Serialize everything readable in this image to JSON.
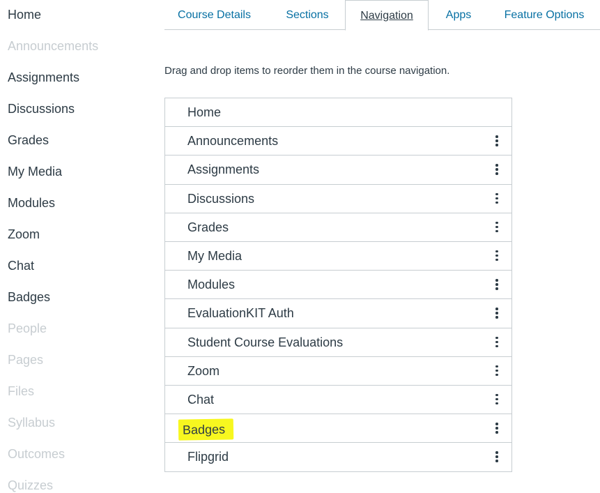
{
  "sidebar": {
    "items": [
      {
        "label": "Home",
        "hidden": false
      },
      {
        "label": "Announcements",
        "hidden": true
      },
      {
        "label": "Assignments",
        "hidden": false
      },
      {
        "label": "Discussions",
        "hidden": false
      },
      {
        "label": "Grades",
        "hidden": false
      },
      {
        "label": "My Media",
        "hidden": false
      },
      {
        "label": "Modules",
        "hidden": false
      },
      {
        "label": "Zoom",
        "hidden": false
      },
      {
        "label": "Chat",
        "hidden": false
      },
      {
        "label": "Badges",
        "hidden": false
      },
      {
        "label": "People",
        "hidden": true
      },
      {
        "label": "Pages",
        "hidden": true
      },
      {
        "label": "Files",
        "hidden": true
      },
      {
        "label": "Syllabus",
        "hidden": true
      },
      {
        "label": "Outcomes",
        "hidden": true
      },
      {
        "label": "Quizzes",
        "hidden": true
      }
    ]
  },
  "tabs": [
    {
      "label": "Course Details",
      "selected": false
    },
    {
      "label": "Sections",
      "selected": false
    },
    {
      "label": "Navigation",
      "selected": true
    },
    {
      "label": "Apps",
      "selected": false
    },
    {
      "label": "Feature Options",
      "selected": false
    }
  ],
  "instructions": "Drag and drop items to reorder them in the course navigation.",
  "nav_items": [
    {
      "label": "Home",
      "has_menu": false
    },
    {
      "label": "Announcements",
      "has_menu": true
    },
    {
      "label": "Assignments",
      "has_menu": true
    },
    {
      "label": "Discussions",
      "has_menu": true
    },
    {
      "label": "Grades",
      "has_menu": true
    },
    {
      "label": "My Media",
      "has_menu": true
    },
    {
      "label": "Modules",
      "has_menu": true
    },
    {
      "label": "EvaluationKIT Auth",
      "has_menu": true
    },
    {
      "label": "Student Course Evaluations",
      "has_menu": true
    },
    {
      "label": "Zoom",
      "has_menu": true
    },
    {
      "label": "Chat",
      "has_menu": true
    },
    {
      "label": "Badges",
      "has_menu": true,
      "highlighted": true
    },
    {
      "label": "Flipgrid",
      "has_menu": true
    }
  ],
  "icons": {
    "row_menu": "kebab-menu-icon"
  },
  "colors": {
    "link": "#0770a3",
    "text": "#2d3b45",
    "hidden": "#c7cdd1",
    "highlight": "#f7f71f",
    "border": "#c7cdd1"
  }
}
